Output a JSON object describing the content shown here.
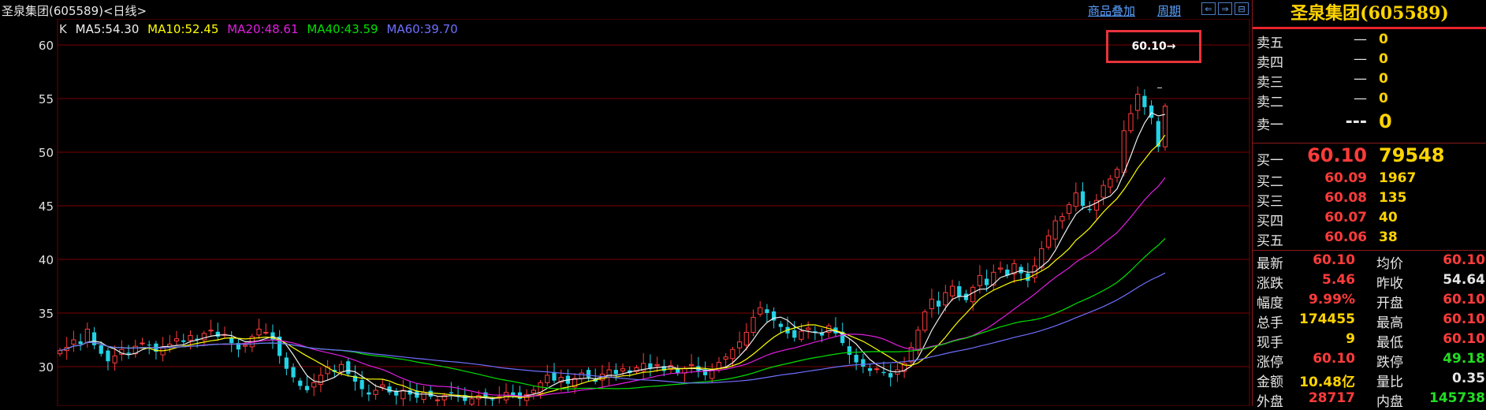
{
  "header": {
    "title": "圣泉集团(605589)<日线>",
    "overlay_link": "商品叠加",
    "period_link": "周期",
    "nav_buttons": [
      "⇐",
      "⇒",
      "⊟"
    ]
  },
  "legend": {
    "k": "K",
    "ma5": "MA5:54.30",
    "ma10": "MA10:52.45",
    "ma20": "MA20:48.61",
    "ma40": "MA40:43.59",
    "ma60": "MA60:39.70"
  },
  "annotation": "60.10→",
  "colors": {
    "up": "#ff3b3b",
    "down": "#22d3e6",
    "ma5": "#f0f0f0",
    "ma10": "#ffff00",
    "ma20": "#e01ee0",
    "ma40": "#00e000",
    "ma60": "#6f6fff",
    "grid": "#7a0000"
  },
  "chart_data": {
    "type": "candlestick",
    "ylim": [
      27,
      62
    ],
    "yticks": [
      30,
      35,
      40,
      45,
      50,
      55,
      60
    ],
    "note": "daily candles, close series approximated from chart",
    "closes": [
      31.5,
      31.8,
      32.5,
      32.1,
      33.5,
      32.0,
      31.2,
      30.5,
      31.0,
      31.6,
      31.2,
      31.9,
      32.2,
      32.0,
      31.4,
      31.8,
      32.1,
      32.6,
      32.3,
      32.9,
      32.5,
      33.1,
      33.4,
      32.8,
      33.0,
      32.2,
      31.6,
      32.0,
      32.8,
      33.5,
      33.2,
      32.5,
      31.0,
      29.8,
      29.0,
      28.2,
      27.8,
      28.5,
      29.2,
      30.0,
      29.5,
      30.2,
      29.3,
      28.6,
      27.9,
      27.4,
      27.8,
      28.3,
      27.6,
      27.3,
      27.8,
      27.4,
      27.1,
      27.6,
      27.2,
      26.9,
      27.3,
      27.5,
      27.2,
      26.8,
      27.0,
      27.3,
      27.1,
      26.9,
      27.2,
      27.6,
      27.3,
      27.0,
      27.4,
      27.8,
      28.5,
      29.2,
      28.7,
      29.0,
      28.4,
      28.9,
      29.4,
      29.0,
      28.6,
      29.3,
      29.7,
      29.3,
      29.8,
      29.4,
      29.9,
      30.3,
      29.8,
      30.2,
      29.6,
      30.1,
      29.4,
      29.8,
      30.2,
      29.6,
      29.2,
      29.7,
      30.4,
      30.9,
      31.6,
      32.3,
      33.2,
      34.6,
      35.5,
      35.0,
      34.3,
      33.7,
      33.1,
      32.7,
      33.3,
      33.6,
      33.2,
      32.9,
      33.8,
      33.1,
      32.2,
      31.1,
      30.4,
      30.0,
      29.6,
      29.8,
      29.4,
      29.0,
      29.7,
      30.3,
      31.8,
      33.4,
      35.1,
      36.3,
      35.6,
      36.9,
      37.5,
      36.5,
      36.2,
      37.4,
      38.5,
      37.6,
      38.8,
      39.2,
      38.5,
      39.6,
      38.7,
      38.0,
      39.4,
      41.0,
      42.2,
      43.6,
      44.0,
      45.1,
      46.2,
      45.0,
      44.6,
      45.5,
      46.9,
      47.5,
      48.4,
      52.0,
      53.6,
      55.4,
      54.2,
      53.2,
      50.5,
      54.3
    ]
  },
  "quote": {
    "stock_title": "圣泉集团(605589)",
    "asks": [
      {
        "label": "卖五",
        "price": "—",
        "vol": "0"
      },
      {
        "label": "卖四",
        "price": "—",
        "vol": "0"
      },
      {
        "label": "卖三",
        "price": "—",
        "vol": "0"
      },
      {
        "label": "卖二",
        "price": "—",
        "vol": "0"
      },
      {
        "label": "卖一",
        "price": "---",
        "vol": "0"
      }
    ],
    "bids": [
      {
        "label": "买一",
        "price": "60.10",
        "vol": "79548"
      },
      {
        "label": "买二",
        "price": "60.09",
        "vol": "1967"
      },
      {
        "label": "买三",
        "price": "60.08",
        "vol": "135"
      },
      {
        "label": "买四",
        "price": "60.07",
        "vol": "40"
      },
      {
        "label": "买五",
        "price": "60.06",
        "vol": "38"
      }
    ],
    "stats": [
      {
        "l1": "最新",
        "v1": "60.10",
        "c1": "#ff3b3b",
        "l2": "均价",
        "v2": "60.10",
        "c2": "#ff3b3b"
      },
      {
        "l1": "涨跌",
        "v1": "5.46",
        "c1": "#ff3b3b",
        "l2": "昨收",
        "v2": "54.64",
        "c2": "#e6e6e6"
      },
      {
        "l1": "幅度",
        "v1": "9.99%",
        "c1": "#ff3b3b",
        "l2": "开盘",
        "v2": "60.10",
        "c2": "#ff3b3b"
      },
      {
        "l1": "总手",
        "v1": "174455",
        "c1": "#ffd400",
        "l2": "最高",
        "v2": "60.10",
        "c2": "#ff3b3b"
      },
      {
        "l1": "现手",
        "v1": "9",
        "c1": "#ffd400",
        "l2": "最低",
        "v2": "60.10",
        "c2": "#ff3b3b"
      },
      {
        "l1": "涨停",
        "v1": "60.10",
        "c1": "#ff3b3b",
        "l2": "跌停",
        "v2": "49.18",
        "c2": "#22dd22"
      },
      {
        "l1": "金额",
        "v1": "10.48亿",
        "c1": "#ffd400",
        "l2": "量比",
        "v2": "0.35",
        "c2": "#e6e6e6"
      },
      {
        "l1": "外盘",
        "v1": "28717",
        "c1": "#ff3b3b",
        "l2": "内盘",
        "v2": "145738",
        "c2": "#22dd22"
      }
    ]
  }
}
